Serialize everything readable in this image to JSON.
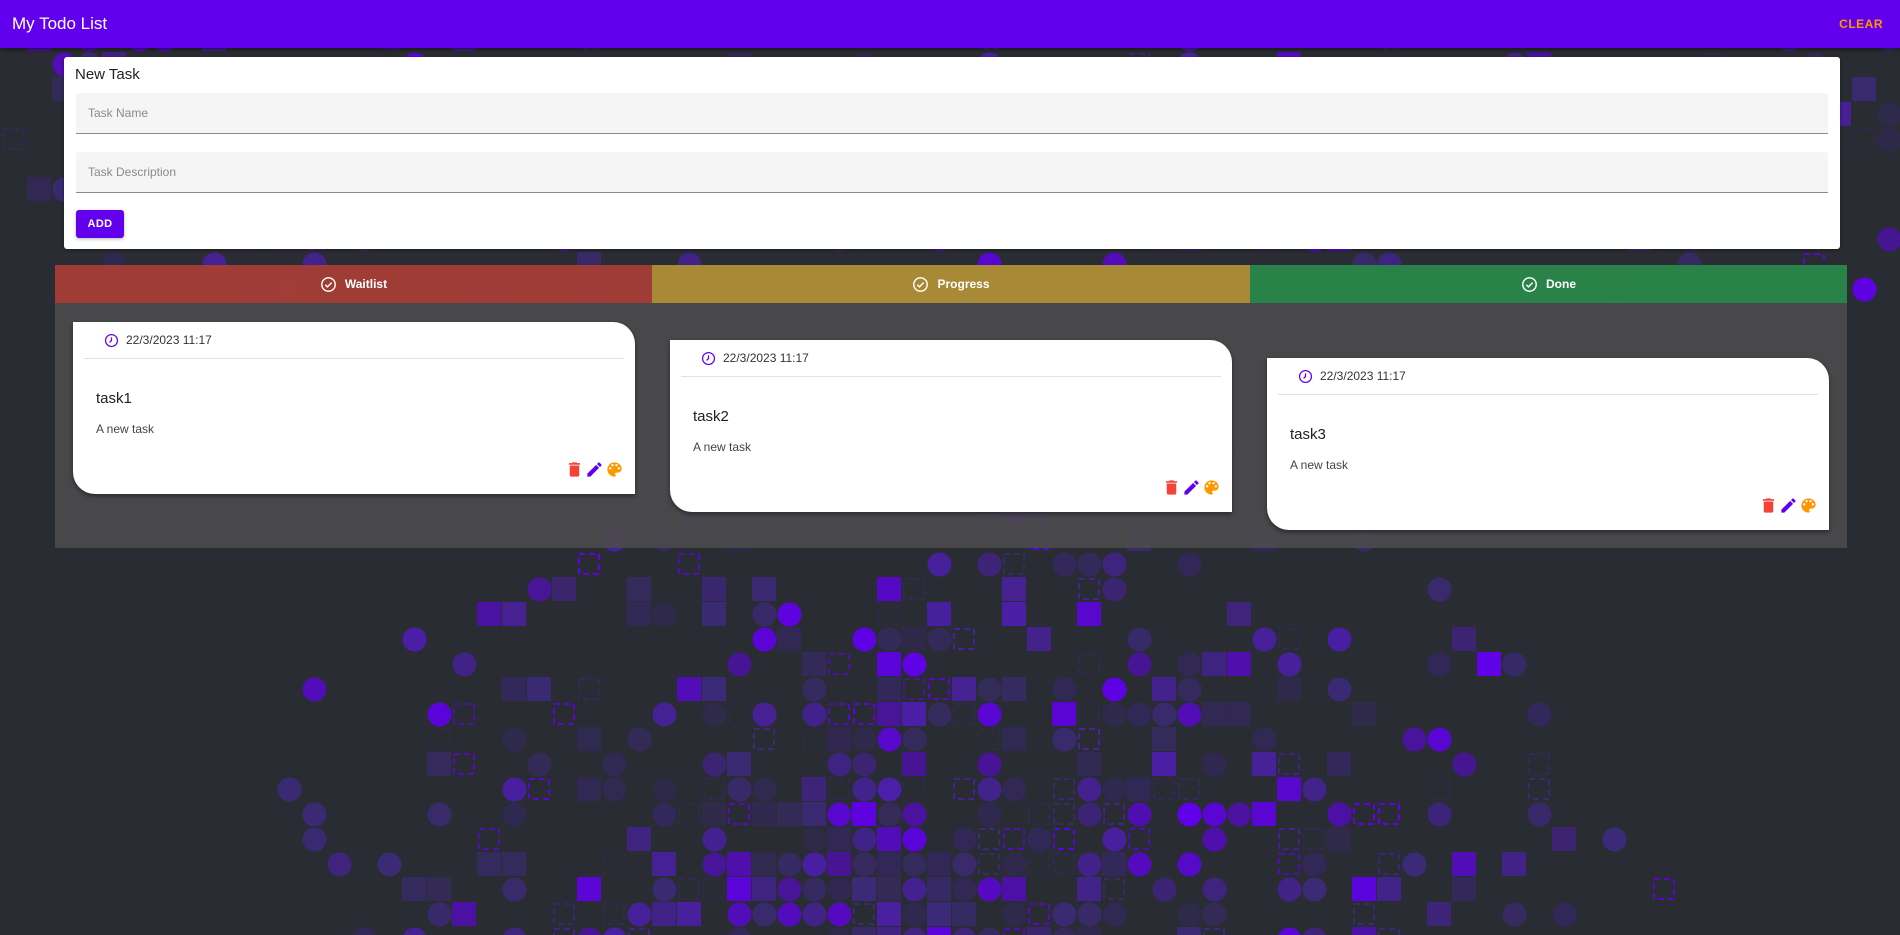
{
  "app": {
    "title": "My Todo List",
    "clear_label": "CLEAR"
  },
  "colors": {
    "primary": "#6200ee",
    "accent": "#ff9800",
    "waitlist": "#b23a32",
    "progress": "#ba9632",
    "done": "#248a48",
    "delete": "#f44336",
    "background": "#2a2c34"
  },
  "new_task": {
    "title": "New Task",
    "name_placeholder": "Task Name",
    "description_placeholder": "Task Description",
    "name_value": "",
    "description_value": "",
    "add_label": "ADD"
  },
  "columns": [
    {
      "name": "Waitlist",
      "icon": "check-circle-icon",
      "tasks": [
        {
          "date": "22/3/2023 11:17",
          "title": "task1",
          "description": "A new task"
        }
      ]
    },
    {
      "name": "Progress",
      "icon": "check-circle-icon",
      "tasks": [
        {
          "date": "22/3/2023 11:17",
          "title": "task2",
          "description": "A new task"
        }
      ]
    },
    {
      "name": "Done",
      "icon": "check-circle-icon",
      "tasks": [
        {
          "date": "22/3/2023 11:17",
          "title": "task3",
          "description": "A new task"
        }
      ]
    }
  ],
  "card_icons": [
    "clock-icon",
    "delete-icon",
    "edit-icon",
    "palette-icon"
  ]
}
